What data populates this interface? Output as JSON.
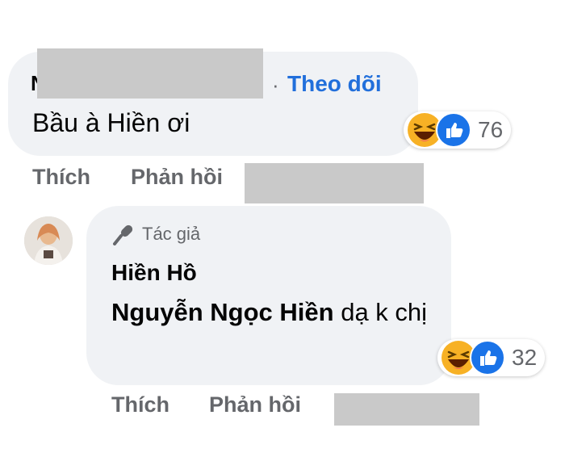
{
  "top_comment": {
    "name_visible_fragment": "N          n",
    "follow_label": "Theo dõi",
    "separator": "·",
    "text": "Bầu à Hiền ơi",
    "reactions": {
      "types": [
        "haha-icon",
        "like-icon"
      ],
      "count": "76"
    },
    "actions": {
      "like": "Thích",
      "reply": "Phản hồi"
    }
  },
  "reply": {
    "badge_label": "Tác giả",
    "author": "Hiền Hồ",
    "mention": "Nguyễn Ngọc Hiền",
    "text": " dạ k chị",
    "reactions": {
      "types": [
        "haha-icon",
        "like-icon"
      ],
      "count": "32"
    },
    "actions": {
      "like": "Thích",
      "reply": "Phản hồi"
    }
  },
  "colors": {
    "bubble": "#f0f2f5",
    "link": "#216fdb",
    "meta": "#65676b",
    "redaction": "#c9c9c9"
  }
}
